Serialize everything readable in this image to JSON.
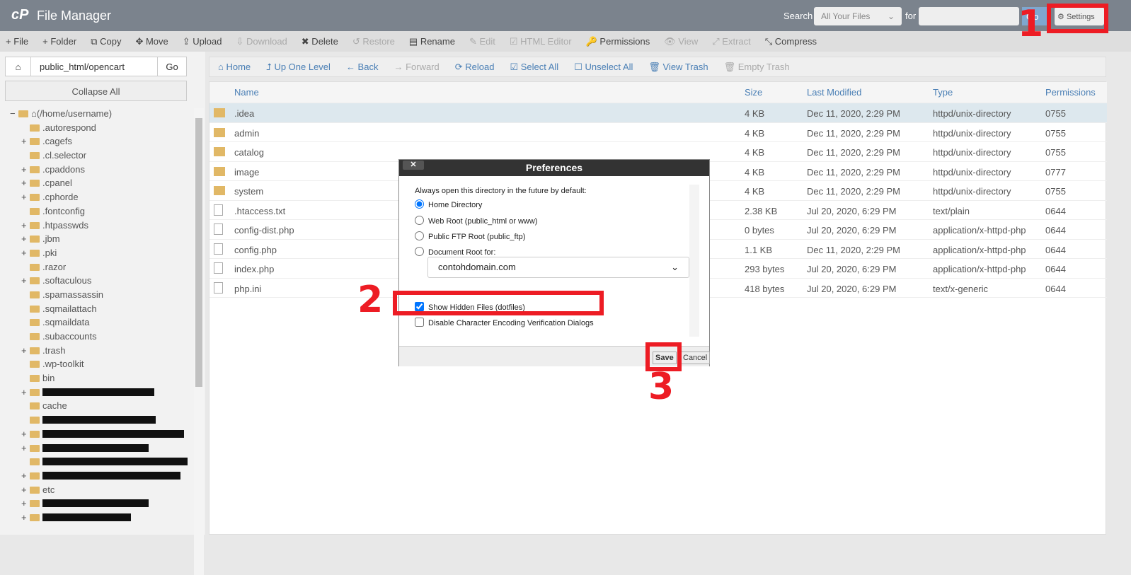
{
  "header": {
    "logo": "cP",
    "title": "File Manager",
    "search_label": "Search",
    "search_scope": "All Your Files",
    "for_label": "for",
    "search_value": "",
    "go": "Go",
    "settings": "Settings"
  },
  "toolbar": [
    {
      "label": "+ File",
      "d": false
    },
    {
      "label": "+ Folder",
      "d": false
    },
    {
      "label": "⧉ Copy",
      "d": false
    },
    {
      "label": "✥ Move",
      "d": false
    },
    {
      "label": "⇪ Upload",
      "d": false
    },
    {
      "label": "⇩ Download",
      "d": true
    },
    {
      "label": "✖ Delete",
      "d": false
    },
    {
      "label": "↺ Restore",
      "d": true
    },
    {
      "label": "▤ Rename",
      "d": false
    },
    {
      "label": "✎ Edit",
      "d": true
    },
    {
      "label": "☑ HTML Editor",
      "d": true
    },
    {
      "label": "🔑 Permissions",
      "d": false
    },
    {
      "label": "👁 View",
      "d": true
    },
    {
      "label": "⤢ Extract",
      "d": true
    },
    {
      "label": "⤡ Compress",
      "d": false
    }
  ],
  "left": {
    "path": "public_html/opencart",
    "go": "Go",
    "collapse": "Collapse All",
    "root": "(/home/username)",
    "tree": [
      {
        "n": ".autorespond",
        "p": false
      },
      {
        "n": ".cagefs",
        "p": true
      },
      {
        "n": ".cl.selector",
        "p": false
      },
      {
        "n": ".cpaddons",
        "p": true
      },
      {
        "n": ".cpanel",
        "p": true
      },
      {
        "n": ".cphorde",
        "p": true
      },
      {
        "n": ".fontconfig",
        "p": false
      },
      {
        "n": ".htpasswds",
        "p": true
      },
      {
        "n": ".jbm",
        "p": true
      },
      {
        "n": ".pki",
        "p": true
      },
      {
        "n": ".razor",
        "p": false
      },
      {
        "n": ".softaculous",
        "p": true
      },
      {
        "n": ".spamassassin",
        "p": false
      },
      {
        "n": ".sqmailattach",
        "p": false
      },
      {
        "n": ".sqmaildata",
        "p": false
      },
      {
        "n": ".subaccounts",
        "p": false
      },
      {
        "n": ".trash",
        "p": true
      },
      {
        "n": ".wp-toolkit",
        "p": false
      },
      {
        "n": "bin",
        "p": false
      },
      {
        "n": "",
        "p": true,
        "r": 158
      },
      {
        "n": "cache",
        "p": false
      },
      {
        "n": "",
        "p": false,
        "r": 160
      },
      {
        "n": "",
        "p": true,
        "r": 200
      },
      {
        "n": "",
        "p": true,
        "r": 150
      },
      {
        "n": "",
        "p": false,
        "r": 205
      },
      {
        "n": "",
        "p": true,
        "r": 195
      },
      {
        "n": "etc",
        "p": true
      },
      {
        "n": "",
        "p": true,
        "r": 150
      },
      {
        "n": "",
        "p": true,
        "r": 125
      }
    ]
  },
  "nav": [
    {
      "label": "⌂ Home",
      "d": false
    },
    {
      "label": "⮥ Up One Level",
      "d": false
    },
    {
      "label": "← Back",
      "d": false
    },
    {
      "label": "→ Forward",
      "d": true
    },
    {
      "label": "⟳ Reload",
      "d": false
    },
    {
      "label": "☑ Select All",
      "d": false
    },
    {
      "label": "☐ Unselect All",
      "d": false
    },
    {
      "label": "🗑 View Trash",
      "d": false
    },
    {
      "label": "🗑 Empty Trash",
      "d": true
    }
  ],
  "table": {
    "headers": [
      "Name",
      "Size",
      "Last Modified",
      "Type",
      "Permissions"
    ],
    "rows": [
      [
        ".idea",
        "4 KB",
        "Dec 11, 2020, 2:29 PM",
        "httpd/unix-directory",
        "0755",
        "d"
      ],
      [
        "admin",
        "4 KB",
        "Dec 11, 2020, 2:29 PM",
        "httpd/unix-directory",
        "0755",
        "d"
      ],
      [
        "catalog",
        "4 KB",
        "Dec 11, 2020, 2:29 PM",
        "httpd/unix-directory",
        "0755",
        "d"
      ],
      [
        "image",
        "4 KB",
        "Dec 11, 2020, 2:29 PM",
        "httpd/unix-directory",
        "0777",
        "d"
      ],
      [
        "system",
        "4 KB",
        "Dec 11, 2020, 2:29 PM",
        "httpd/unix-directory",
        "0755",
        "d"
      ],
      [
        ".htaccess.txt",
        "2.38 KB",
        "Jul 20, 2020, 6:29 PM",
        "text/plain",
        "0644",
        "f"
      ],
      [
        "config-dist.php",
        "0 bytes",
        "Jul 20, 2020, 6:29 PM",
        "application/x-httpd-php",
        "0644",
        "f"
      ],
      [
        "config.php",
        "1.1 KB",
        "Dec 11, 2020, 2:29 PM",
        "application/x-httpd-php",
        "0644",
        "f"
      ],
      [
        "index.php",
        "293 bytes",
        "Jul 20, 2020, 6:29 PM",
        "application/x-httpd-php",
        "0644",
        "f"
      ],
      [
        "php.ini",
        "418 bytes",
        "Jul 20, 2020, 6:29 PM",
        "text/x-generic",
        "0644",
        "f"
      ]
    ]
  },
  "modal": {
    "title": "Preferences",
    "close": "✕",
    "intro": "Always open this directory in the future by default:",
    "opt1": "Home Directory",
    "opt2": "Web Root (public_html or www)",
    "opt3": "Public FTP Root (public_ftp)",
    "opt4": "Document Root for:",
    "domain": "contohdomain.com",
    "hidden": "Show Hidden Files (dotfiles)",
    "encoding": "Disable Character Encoding Verification Dialogs",
    "save": "Save",
    "cancel": "Cancel"
  },
  "annotations": [
    "1",
    "2",
    "3"
  ]
}
